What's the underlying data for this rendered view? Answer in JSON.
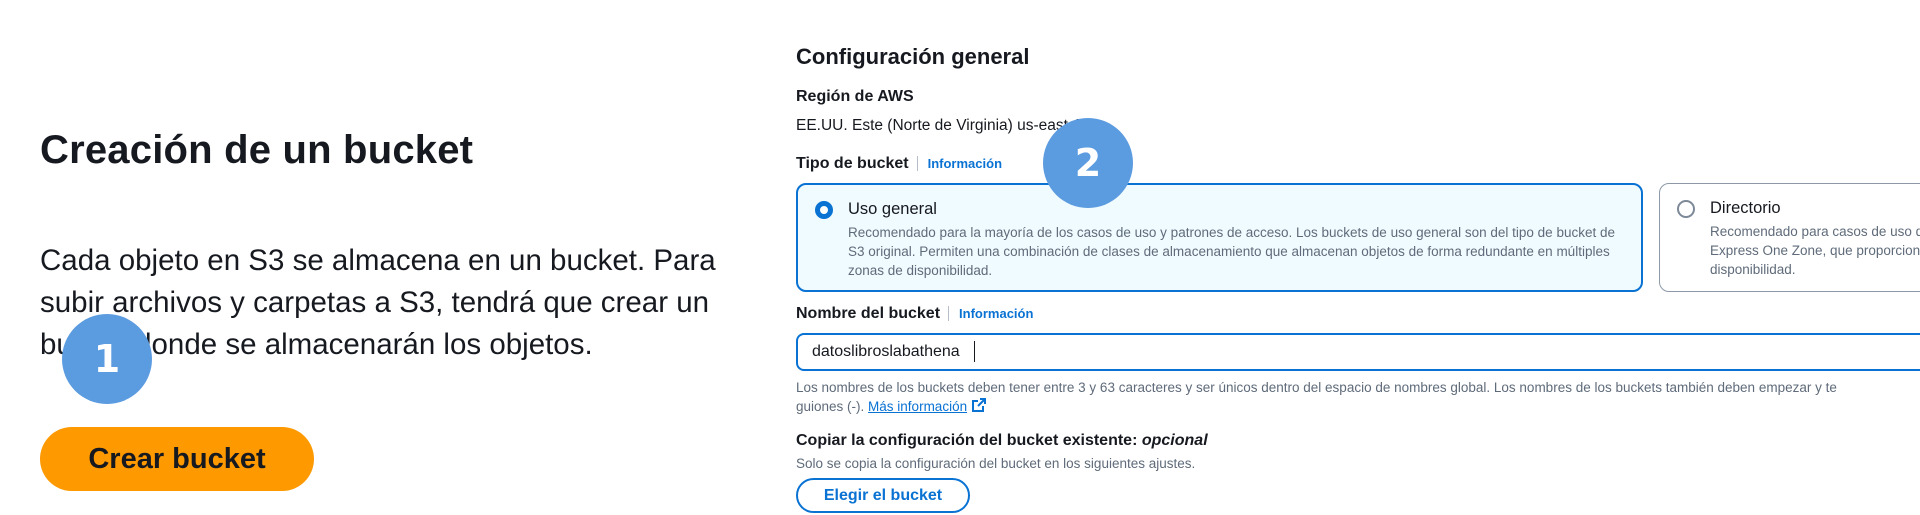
{
  "left_panel": {
    "title": "Creación de un bucket",
    "description": "Cada objeto en S3 se almacena en un bucket. Para subir archivos y carpetas a S3, tendrá que crear un bucket donde se almacenarán los objetos.",
    "create_button_label": "Crear bucket"
  },
  "step_badges": [
    "1",
    "2"
  ],
  "general_config": {
    "section_title": "Configuración general",
    "region_label": "Región de AWS",
    "region_value": "EE.UU. Este (Norte de Virginia) us-east-1",
    "bucket_type_label": "Tipo de bucket",
    "info_link": "Información",
    "bucket_types": [
      {
        "title": "Uso general",
        "description": "Recomendado para la mayoría de los casos de uso y patrones de acceso. Los buckets de uso general son del tipo de bucket de S3 original. Permiten una combinación de clases de almacenamiento que almacenan objetos de forma redundante en múltiples zonas de disponibilidad.",
        "selected": true
      },
      {
        "title": "Directorio",
        "description_lines": [
          "Recomendado para casos de uso d",
          "Express One Zone, que proporcion",
          "disponibilidad."
        ],
        "selected": false
      }
    ],
    "bucket_name_label": "Nombre del bucket",
    "bucket_name_value": "datoslibroslabathena",
    "bucket_name_hint": "Los nombres de los buckets deben tener entre 3 y 63 caracteres y ser únicos dentro del espacio de nombres global. Los nombres de los buckets también deben empezar y te",
    "bucket_name_hint_line2": "guiones (-).",
    "more_info_link": "Más información",
    "copy_config_title": "Copiar la configuración del bucket existente:",
    "copy_config_optional": "opcional",
    "copy_config_desc": "Solo se copia la configuración del bucket en los siguientes ajustes.",
    "choose_bucket_button": "Elegir el bucket"
  },
  "colors": {
    "accent_blue": "#0972d3",
    "create_button_orange": "#ff9900",
    "badge_blue": "#5b9be0",
    "selected_card_bg": "#f0fbff"
  },
  "icons": {
    "external_link": "external-link-icon"
  }
}
